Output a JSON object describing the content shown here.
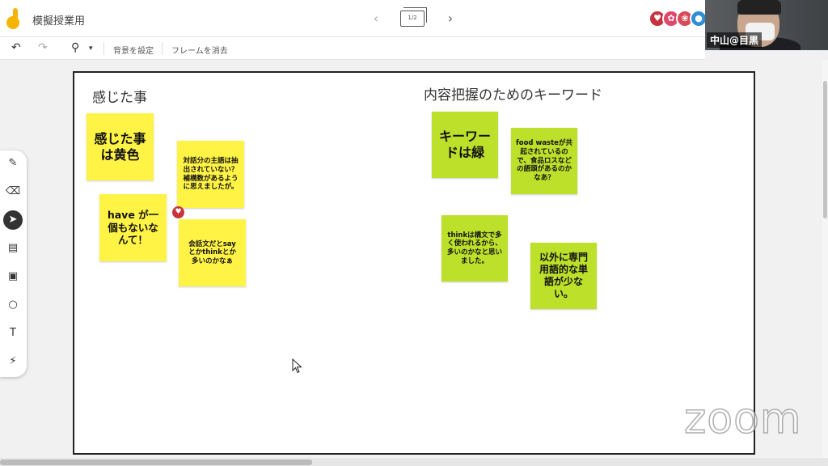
{
  "app": {
    "title": "模擬授業用"
  },
  "frame_nav": {
    "indicator": "1/2",
    "prev_icon": "‹",
    "next_icon": "›"
  },
  "participants": [
    {
      "color": "#c8323c",
      "glyph": "♥"
    },
    {
      "color": "#e0476b",
      "glyph": "✿"
    },
    {
      "color": "#d84a5a",
      "glyph": "❀"
    },
    {
      "color": "#2e8fd6",
      "glyph": "●"
    }
  ],
  "video": {
    "name": "中山@目黒"
  },
  "toolbar": {
    "undo_icon": "↶",
    "redo_icon": "↷",
    "zoom_icon": "⚲",
    "zoom_caret": "▾",
    "set_background": "背景を設定",
    "clear_frame": "フレームを消去"
  },
  "tools": [
    {
      "name": "pen-tool",
      "glyph": "✎"
    },
    {
      "name": "eraser-tool",
      "glyph": "⌫"
    },
    {
      "name": "select-tool",
      "glyph": "➤"
    },
    {
      "name": "sticky-note-tool",
      "glyph": "▤"
    },
    {
      "name": "image-tool",
      "glyph": "▣"
    },
    {
      "name": "shape-tool",
      "glyph": "○"
    },
    {
      "name": "text-box-tool",
      "glyph": "T"
    },
    {
      "name": "laser-tool",
      "glyph": "⚡"
    }
  ],
  "canvas": {
    "heading_left": "感じた事",
    "heading_right": "内容把握のためのキーワード",
    "notes": [
      {
        "text": "感じた事は黄色"
      },
      {
        "text": "対話分の主語は抽出されていない？補構数があるように思えましたが。"
      },
      {
        "text": "have が一個もないなんて！"
      },
      {
        "text": "会話文だとsayとかthinkとか多いのかなぁ"
      },
      {
        "text": "キーワードは緑"
      },
      {
        "text": "food wasteが共起されているので、食品ロスなどの語頭があるのかなあ？"
      },
      {
        "text": "thinkは構文で多く使われるから、多いのかなと思いました。"
      },
      {
        "text": "以外に専門用語的な単語が少ない。"
      }
    ],
    "pin_glyph": "♥"
  },
  "watermark": "zoom"
}
